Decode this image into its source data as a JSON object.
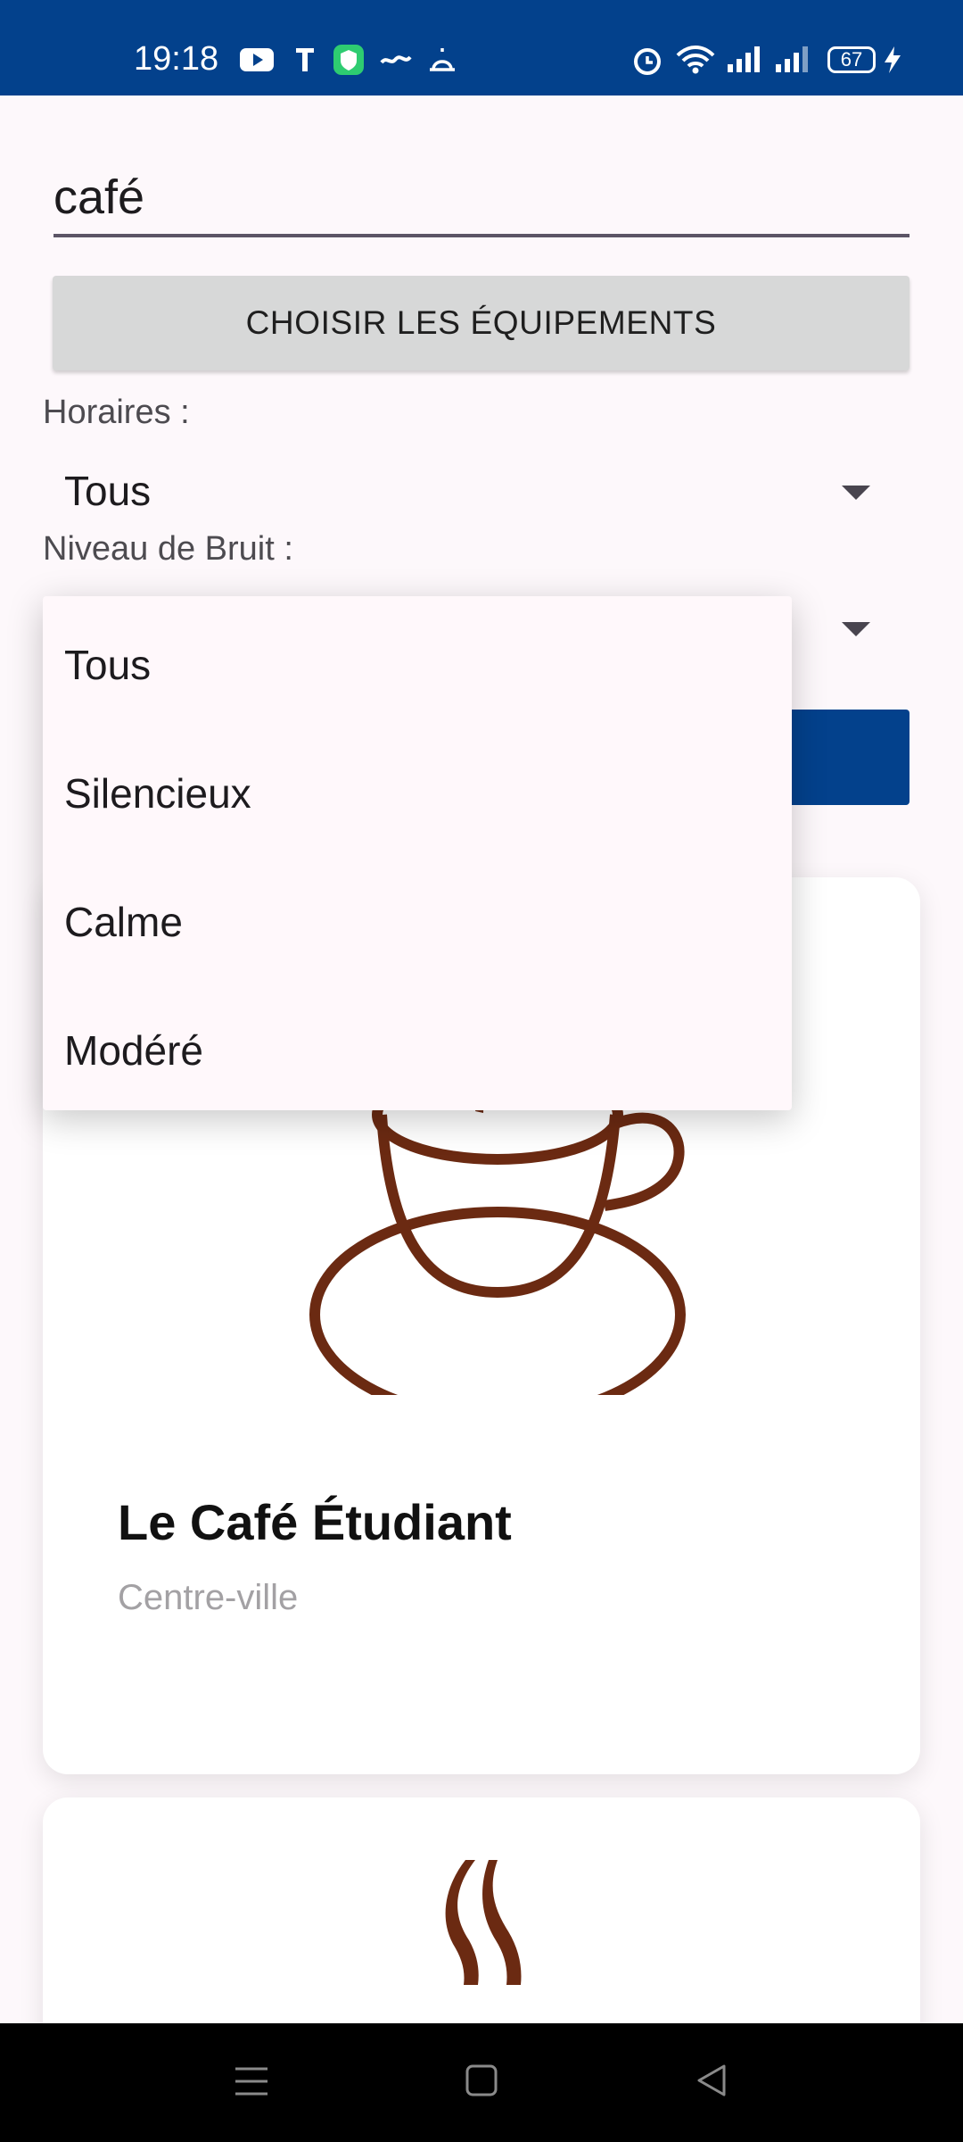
{
  "status_bar": {
    "time": "19:18",
    "battery": "67",
    "icons": [
      "youtube-icon",
      "text-icon",
      "shield-app-icon",
      "azkar-icon",
      "mosque-icon",
      "alarm-icon",
      "wifi-icon",
      "signal-icon",
      "signal-2-icon",
      "charging-icon"
    ]
  },
  "search": {
    "value": "café"
  },
  "equipments_button": "CHOISIR LES ÉQUIPEMENTS",
  "filters": {
    "hours_label": "Horaires :",
    "hours_value": "Tous",
    "noise_label": "Niveau de Bruit :"
  },
  "noise_dropdown": {
    "options": [
      "Tous",
      "Silencieux",
      "Calme",
      "Modéré"
    ]
  },
  "cards": [
    {
      "title": "Le Café Étudiant",
      "subtitle": "Centre-ville",
      "icon": "coffee-cup-icon"
    },
    {
      "icon": "coffee-steam-icon"
    }
  ],
  "colors": {
    "primary": "#03418c",
    "coffee": "#6b2a12",
    "background": "#fdf8fb"
  }
}
